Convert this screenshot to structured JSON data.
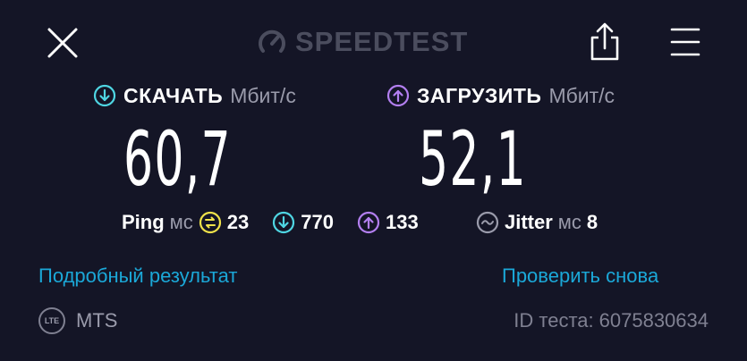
{
  "header": {
    "brand": "SPEEDTEST",
    "icons": {
      "close": "close-icon",
      "share": "share-icon",
      "menu": "menu-icon",
      "gauge": "gauge-icon"
    }
  },
  "download": {
    "label": "СКАЧАТЬ",
    "unit": "Мбит/с",
    "value": "60,7",
    "color": "#4fd6e3"
  },
  "upload": {
    "label": "ЗАГРУЗИТЬ",
    "unit": "Мбит/с",
    "value": "52,1",
    "color": "#b37ff0"
  },
  "stats": {
    "ping_label": "Ping",
    "ping_unit": "мс",
    "ping_idle": "23",
    "ping_download": "770",
    "ping_upload": "133",
    "jitter_label": "Jitter",
    "jitter_unit": "мс",
    "jitter_value": "8",
    "colors": {
      "idle": "#f0e24a",
      "download": "#4fd6e3",
      "upload": "#b37ff0",
      "jitter": "#9a9bab"
    }
  },
  "links": {
    "details": "Подробный результат",
    "retry": "Проверить снова"
  },
  "footer": {
    "network_badge": "LTE",
    "provider": "MTS",
    "test_id_label": "ID теста:",
    "test_id_value": "6075830634"
  }
}
